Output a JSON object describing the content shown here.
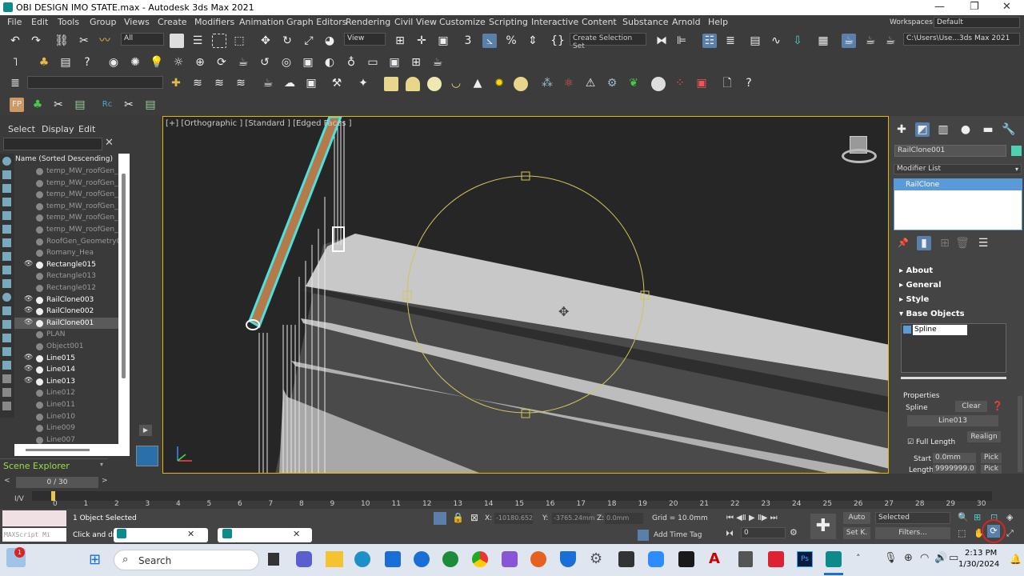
{
  "window": {
    "title": "OBI DESIGN IMO STATE.max - Autodesk 3ds Max 2021"
  },
  "menu": [
    "File",
    "Edit",
    "Tools",
    "Group",
    "Views",
    "Create",
    "Modifiers",
    "Animation",
    "Graph Editors",
    "Rendering",
    "Civil View",
    "Customize",
    "Scripting",
    "Interactive",
    "Content",
    "Substance",
    "Arnold",
    "Help"
  ],
  "workspaces": {
    "label": "Workspaces:",
    "value": "Default"
  },
  "toolbar": {
    "filter_value": "All",
    "ref_coord_value": "View",
    "selection_set_placeholder": "Create Selection Set",
    "path_value": "C:\\Users\\Use...3ds Max 2021"
  },
  "scene_explorer": {
    "tabs": [
      "Select",
      "Display",
      "Edit"
    ],
    "column_header": "Name (Sorted Descending)",
    "footer": "Scene Explorer",
    "rows": [
      {
        "name": "temp_MW_roofGen_roo",
        "bright": false
      },
      {
        "name": "temp_MW_roofGen_roo",
        "bright": false
      },
      {
        "name": "temp_MW_roofGen_roo",
        "bright": false
      },
      {
        "name": "temp_MW_roofGen_roo",
        "bright": false
      },
      {
        "name": "temp_MW_roofGen_roo",
        "bright": false
      },
      {
        "name": "temp_MW_roofGen_roo",
        "bright": false
      },
      {
        "name": "RoofGen_Geometry002",
        "bright": false
      },
      {
        "name": "Romany_Hea",
        "bright": false
      },
      {
        "name": "Rectangle015",
        "bright": true
      },
      {
        "name": "Rectangle013",
        "bright": false
      },
      {
        "name": "Rectangle012",
        "bright": false
      },
      {
        "name": "RailClone003",
        "bright": true
      },
      {
        "name": "RailClone002",
        "bright": true
      },
      {
        "name": "RailClone001",
        "bright": true
      },
      {
        "name": "PLAN",
        "bright": false
      },
      {
        "name": "Object001",
        "bright": false
      },
      {
        "name": "Line015",
        "bright": true
      },
      {
        "name": "Line014",
        "bright": true
      },
      {
        "name": "Line013",
        "bright": true
      },
      {
        "name": "Line012",
        "bright": false
      },
      {
        "name": "Line011",
        "bright": false
      },
      {
        "name": "Line010",
        "bright": false
      },
      {
        "name": "Line009",
        "bright": false
      },
      {
        "name": "Line007",
        "bright": false
      }
    ]
  },
  "viewport": {
    "label": "[+] [Orthographic ] [Standard ] [Edged Faces ]"
  },
  "command_panel": {
    "object_name": "RailClone001",
    "modifier_list_label": "Modifier List",
    "modifier_stack": [
      "RailClone"
    ],
    "rollouts": [
      "About",
      "General",
      "Style",
      "Base Objects"
    ],
    "base_objects": [
      "Spline"
    ],
    "properties": {
      "header": "Properties",
      "spline_label": "Spline",
      "clear_button": "Clear",
      "spline_value": "Line013",
      "realign_button": "Realign",
      "full_length_label": "Full Length",
      "start_label": "Start",
      "start_value": "0.0mm",
      "pick1": "Pick",
      "length_label": "Length",
      "length_value": "9999999.0",
      "pick2": "Pick"
    }
  },
  "timeline": {
    "frame": "0 / 30",
    "ticks": [
      "0",
      "1",
      "2",
      "3",
      "4",
      "5",
      "6",
      "7",
      "8",
      "9",
      "10",
      "11",
      "12",
      "13",
      "14",
      "15",
      "16",
      "17",
      "18",
      "19",
      "20",
      "21",
      "22",
      "23",
      "24",
      "25",
      "26",
      "27",
      "28",
      "29",
      "30"
    ]
  },
  "status": {
    "maxscript": "MAXScript Mi",
    "selected": "1 Object Selected",
    "prompt": "Click and dra",
    "x_label": "X:",
    "x_value": "-10180.652",
    "y_label": "Y:",
    "y_value": "-3765.24mm",
    "z_label": "Z:",
    "z_value": "0.0mm",
    "grid": "Grid = 10.0mm",
    "add_time_tag": "Add Time Tag",
    "auto": "Auto",
    "set_key": "Set K.",
    "selected_dd": "Selected",
    "filters": "Filters...",
    "frame_input": "0"
  },
  "taskbar": {
    "search": "Search",
    "time": "2:13 PM",
    "date": "1/30/2024",
    "badge": "1"
  }
}
